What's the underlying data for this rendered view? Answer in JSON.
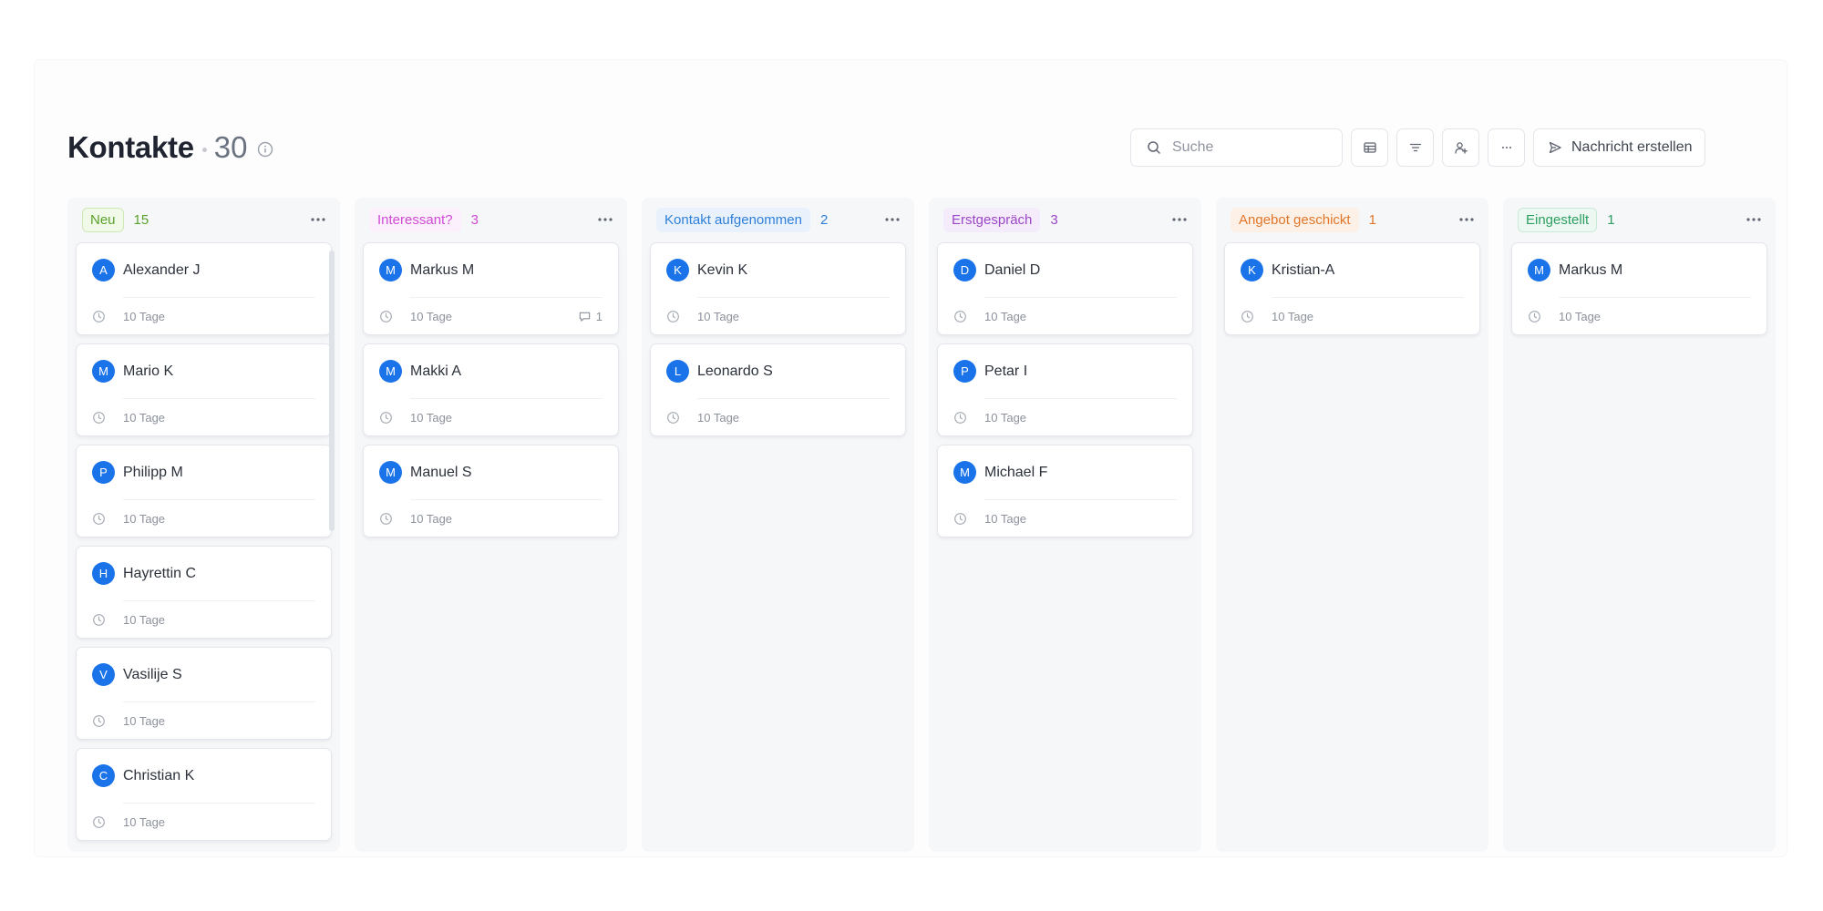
{
  "header": {
    "title": "Kontakte",
    "count": "30"
  },
  "toolbar": {
    "search_placeholder": "Suche",
    "table_view_icon": "table-icon",
    "filter_icon": "filter-icon",
    "add_user_icon": "add-user-icon",
    "more_icon": "more-horizontal-icon",
    "message_button_label": "Nachricht erstellen"
  },
  "colors": {
    "avatar": "#1a73e8"
  },
  "columns": [
    {
      "label": "Neu",
      "count": "15",
      "color": "#5aa02c",
      "bg": "#f1f9e9",
      "border": "#cfe8b7",
      "cards": [
        {
          "initial": "A",
          "name": "Alexander J",
          "age": "10 Tage"
        },
        {
          "initial": "M",
          "name": "Mario K",
          "age": "10 Tage"
        },
        {
          "initial": "P",
          "name": "Philipp M",
          "age": "10 Tage"
        },
        {
          "initial": "H",
          "name": "Hayrettin C",
          "age": "10 Tage"
        },
        {
          "initial": "V",
          "name": "Vasilije S",
          "age": "10 Tage"
        },
        {
          "initial": "C",
          "name": "Christian K",
          "age": "10 Tage"
        }
      ]
    },
    {
      "label": "Interessant?",
      "count": "3",
      "color": "#d04ad6",
      "bg": "#fcf0fc",
      "border": "#fcf0fc",
      "cards": [
        {
          "initial": "M",
          "name": "Markus M",
          "age": "10 Tage",
          "comments": "1"
        },
        {
          "initial": "M",
          "name": "Makki A",
          "age": "10 Tage"
        },
        {
          "initial": "M",
          "name": "Manuel S",
          "age": "10 Tage"
        }
      ]
    },
    {
      "label": "Kontakt aufgenommen",
      "count": "2",
      "color": "#2f7fd8",
      "bg": "#e9f2fc",
      "border": "#e9f2fc",
      "cards": [
        {
          "initial": "K",
          "name": "Kevin K",
          "age": "10 Tage"
        },
        {
          "initial": "L",
          "name": "Leonardo S",
          "age": "10 Tage"
        }
      ]
    },
    {
      "label": "Erstgespräch",
      "count": "3",
      "color": "#9b46c8",
      "bg": "#f5ecfb",
      "border": "#f5ecfb",
      "cards": [
        {
          "initial": "D",
          "name": "Daniel D",
          "age": "10 Tage"
        },
        {
          "initial": "P",
          "name": "Petar I",
          "age": "10 Tage"
        },
        {
          "initial": "M",
          "name": "Michael F",
          "age": "10 Tage"
        }
      ]
    },
    {
      "label": "Angebot geschickt",
      "count": "1",
      "color": "#e0762a",
      "bg": "#fdf1e7",
      "border": "#fdf1e7",
      "cards": [
        {
          "initial": "K",
          "name": "Kristian-A",
          "age": "10 Tage"
        }
      ]
    },
    {
      "label": "Eingestellt",
      "count": "1",
      "color": "#2e9f62",
      "bg": "#ecf8f1",
      "border": "#c9ead7",
      "cards": [
        {
          "initial": "M",
          "name": "Markus M",
          "age": "10 Tage"
        }
      ]
    }
  ]
}
